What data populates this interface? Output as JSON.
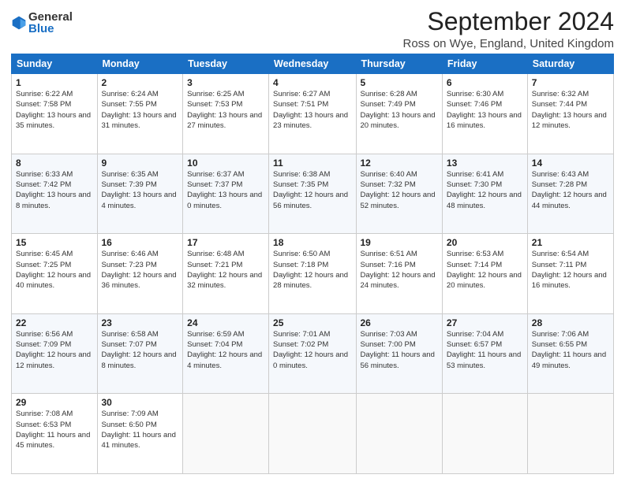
{
  "logo": {
    "general": "General",
    "blue": "Blue"
  },
  "title": "September 2024",
  "location": "Ross on Wye, England, United Kingdom",
  "days_of_week": [
    "Sunday",
    "Monday",
    "Tuesday",
    "Wednesday",
    "Thursday",
    "Friday",
    "Saturday"
  ],
  "weeks": [
    [
      {
        "day": "1",
        "sunrise": "6:22 AM",
        "sunset": "7:58 PM",
        "daylight": "13 hours and 35 minutes."
      },
      {
        "day": "2",
        "sunrise": "6:24 AM",
        "sunset": "7:55 PM",
        "daylight": "13 hours and 31 minutes."
      },
      {
        "day": "3",
        "sunrise": "6:25 AM",
        "sunset": "7:53 PM",
        "daylight": "13 hours and 27 minutes."
      },
      {
        "day": "4",
        "sunrise": "6:27 AM",
        "sunset": "7:51 PM",
        "daylight": "13 hours and 23 minutes."
      },
      {
        "day": "5",
        "sunrise": "6:28 AM",
        "sunset": "7:49 PM",
        "daylight": "13 hours and 20 minutes."
      },
      {
        "day": "6",
        "sunrise": "6:30 AM",
        "sunset": "7:46 PM",
        "daylight": "13 hours and 16 minutes."
      },
      {
        "day": "7",
        "sunrise": "6:32 AM",
        "sunset": "7:44 PM",
        "daylight": "13 hours and 12 minutes."
      }
    ],
    [
      {
        "day": "8",
        "sunrise": "6:33 AM",
        "sunset": "7:42 PM",
        "daylight": "13 hours and 8 minutes."
      },
      {
        "day": "9",
        "sunrise": "6:35 AM",
        "sunset": "7:39 PM",
        "daylight": "13 hours and 4 minutes."
      },
      {
        "day": "10",
        "sunrise": "6:37 AM",
        "sunset": "7:37 PM",
        "daylight": "13 hours and 0 minutes."
      },
      {
        "day": "11",
        "sunrise": "6:38 AM",
        "sunset": "7:35 PM",
        "daylight": "12 hours and 56 minutes."
      },
      {
        "day": "12",
        "sunrise": "6:40 AM",
        "sunset": "7:32 PM",
        "daylight": "12 hours and 52 minutes."
      },
      {
        "day": "13",
        "sunrise": "6:41 AM",
        "sunset": "7:30 PM",
        "daylight": "12 hours and 48 minutes."
      },
      {
        "day": "14",
        "sunrise": "6:43 AM",
        "sunset": "7:28 PM",
        "daylight": "12 hours and 44 minutes."
      }
    ],
    [
      {
        "day": "15",
        "sunrise": "6:45 AM",
        "sunset": "7:25 PM",
        "daylight": "12 hours and 40 minutes."
      },
      {
        "day": "16",
        "sunrise": "6:46 AM",
        "sunset": "7:23 PM",
        "daylight": "12 hours and 36 minutes."
      },
      {
        "day": "17",
        "sunrise": "6:48 AM",
        "sunset": "7:21 PM",
        "daylight": "12 hours and 32 minutes."
      },
      {
        "day": "18",
        "sunrise": "6:50 AM",
        "sunset": "7:18 PM",
        "daylight": "12 hours and 28 minutes."
      },
      {
        "day": "19",
        "sunrise": "6:51 AM",
        "sunset": "7:16 PM",
        "daylight": "12 hours and 24 minutes."
      },
      {
        "day": "20",
        "sunrise": "6:53 AM",
        "sunset": "7:14 PM",
        "daylight": "12 hours and 20 minutes."
      },
      {
        "day": "21",
        "sunrise": "6:54 AM",
        "sunset": "7:11 PM",
        "daylight": "12 hours and 16 minutes."
      }
    ],
    [
      {
        "day": "22",
        "sunrise": "6:56 AM",
        "sunset": "7:09 PM",
        "daylight": "12 hours and 12 minutes."
      },
      {
        "day": "23",
        "sunrise": "6:58 AM",
        "sunset": "7:07 PM",
        "daylight": "12 hours and 8 minutes."
      },
      {
        "day": "24",
        "sunrise": "6:59 AM",
        "sunset": "7:04 PM",
        "daylight": "12 hours and 4 minutes."
      },
      {
        "day": "25",
        "sunrise": "7:01 AM",
        "sunset": "7:02 PM",
        "daylight": "12 hours and 0 minutes."
      },
      {
        "day": "26",
        "sunrise": "7:03 AM",
        "sunset": "7:00 PM",
        "daylight": "11 hours and 56 minutes."
      },
      {
        "day": "27",
        "sunrise": "7:04 AM",
        "sunset": "6:57 PM",
        "daylight": "11 hours and 53 minutes."
      },
      {
        "day": "28",
        "sunrise": "7:06 AM",
        "sunset": "6:55 PM",
        "daylight": "11 hours and 49 minutes."
      }
    ],
    [
      {
        "day": "29",
        "sunrise": "7:08 AM",
        "sunset": "6:53 PM",
        "daylight": "11 hours and 45 minutes."
      },
      {
        "day": "30",
        "sunrise": "7:09 AM",
        "sunset": "6:50 PM",
        "daylight": "11 hours and 41 minutes."
      },
      null,
      null,
      null,
      null,
      null
    ]
  ]
}
